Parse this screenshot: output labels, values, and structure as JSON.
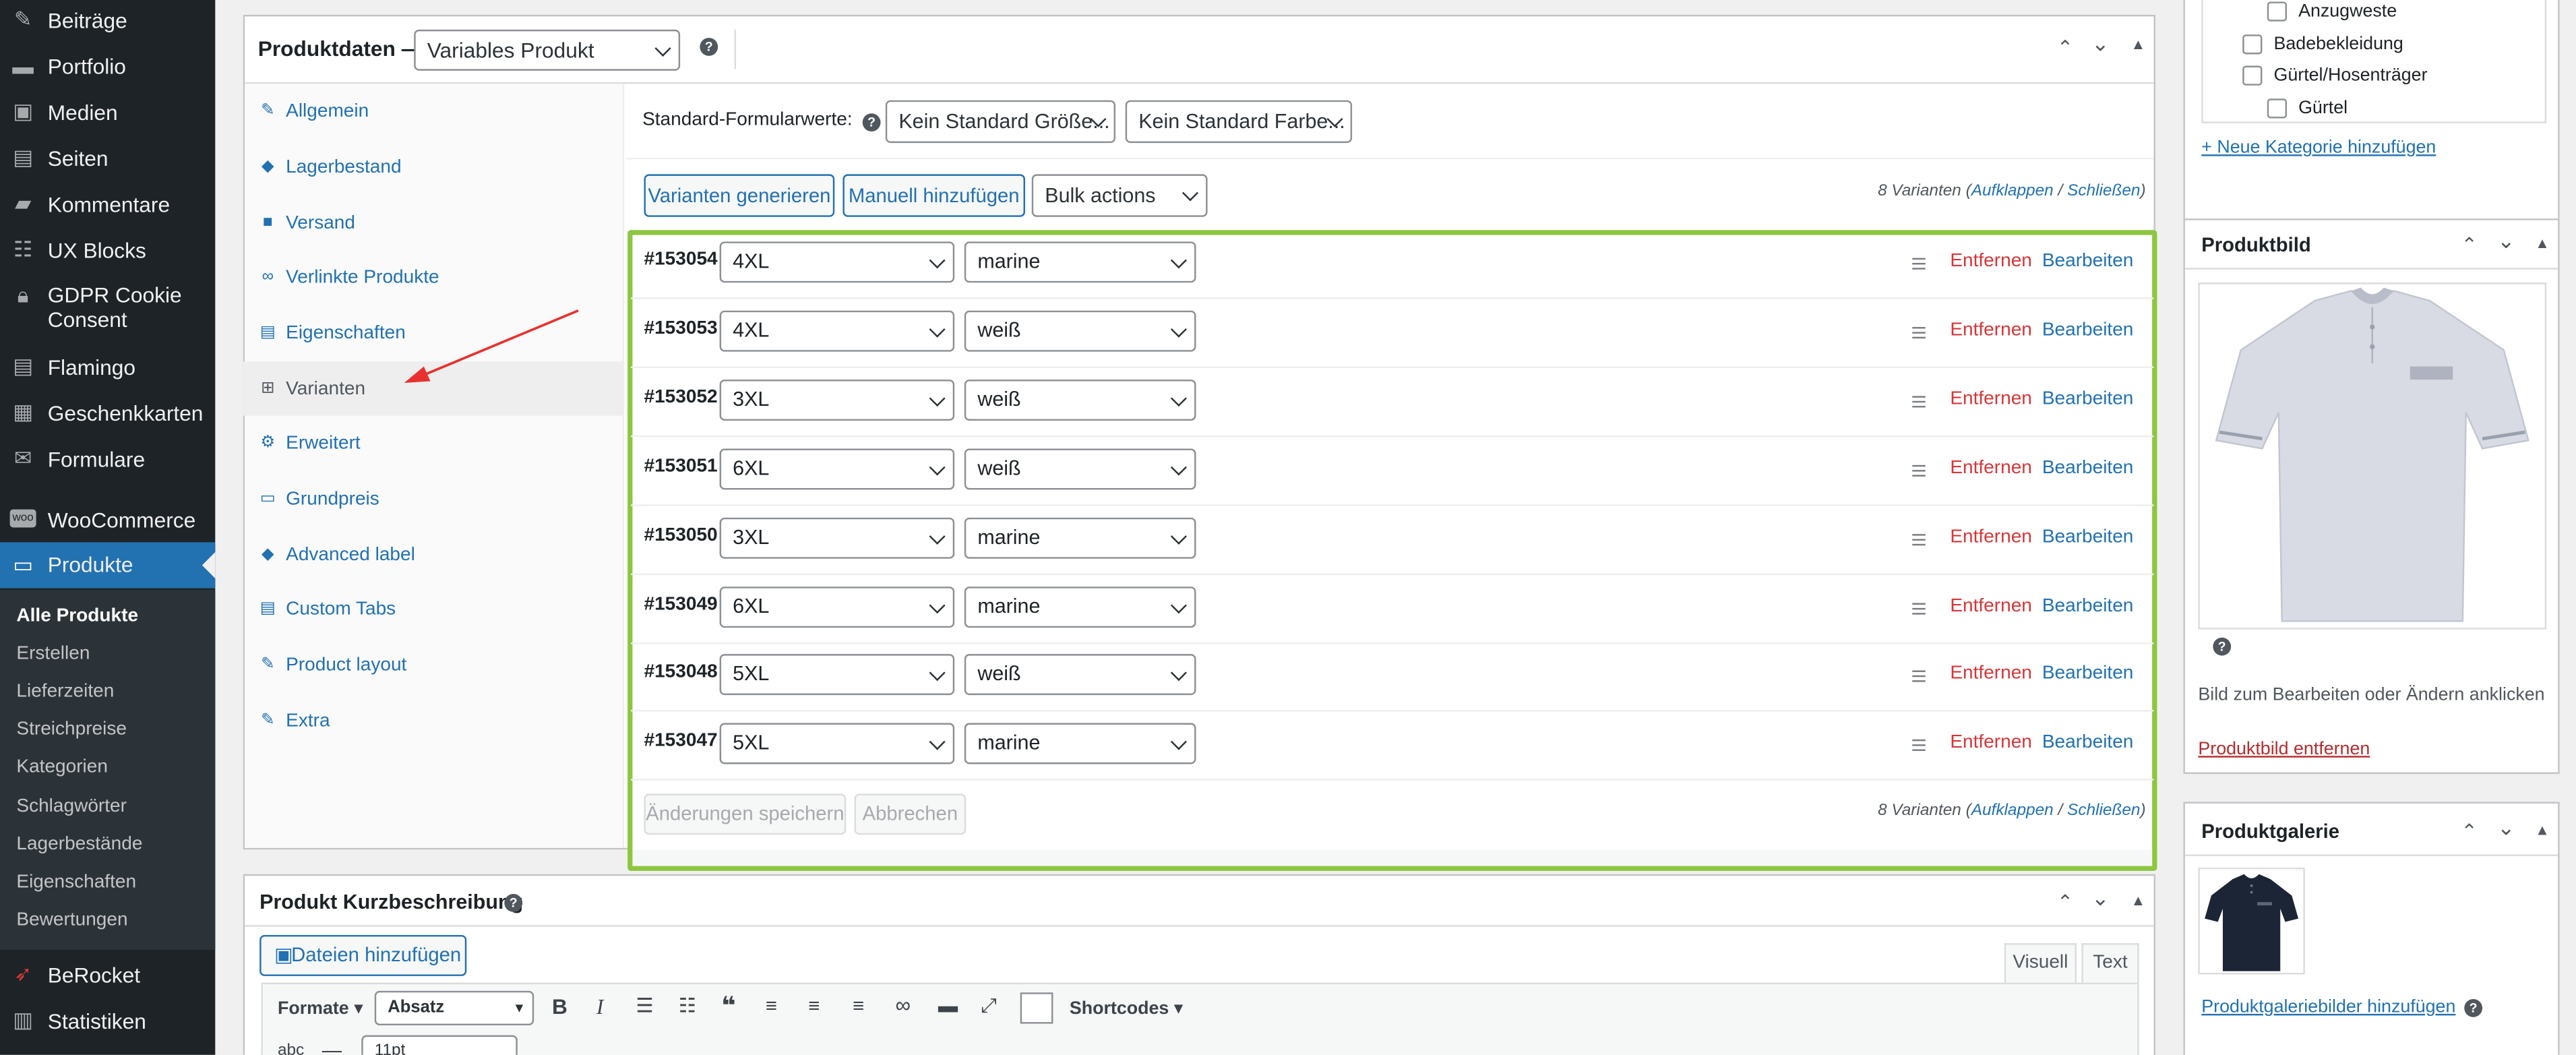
{
  "admin_menu": {
    "items": [
      {
        "label": "Beiträge",
        "icon": "pin-icon"
      },
      {
        "label": "Portfolio",
        "icon": "portfolio-icon"
      },
      {
        "label": "Medien",
        "icon": "media-icon"
      },
      {
        "label": "Seiten",
        "icon": "page-icon"
      },
      {
        "label": "Kommentare",
        "icon": "comment-icon"
      },
      {
        "label": "UX Blocks",
        "icon": "blocks-icon"
      },
      {
        "label": "GDPR Cookie",
        "label2": "Consent",
        "icon": "lock-icon"
      },
      {
        "label": "Flamingo",
        "icon": "flamingo-icon"
      },
      {
        "label": "Geschenkkarten",
        "icon": "giftcard-icon"
      },
      {
        "label": "Formulare",
        "icon": "mail-icon"
      },
      {
        "label": "WooCommerce",
        "icon": "woo-icon"
      },
      {
        "label": "Produkte",
        "icon": "archive-icon"
      },
      {
        "label": "BeRocket",
        "icon": "rocket-icon"
      },
      {
        "label": "Statistiken",
        "icon": "stats-icon"
      }
    ],
    "submenu": [
      "Alle Produkte",
      "Erstellen",
      "Lieferzeiten",
      "Streichpreise",
      "Kategorien",
      "Schlagwörter",
      "Lagerbestände",
      "Eigenschaften",
      "Bewertungen"
    ]
  },
  "product_data": {
    "title": "Produktdaten —",
    "type_select": "Variables Produkt",
    "tabs": [
      {
        "label": "Allgemein",
        "icon": "wrench-icon"
      },
      {
        "label": "Lagerbestand",
        "icon": "tag-icon"
      },
      {
        "label": "Versand",
        "icon": "truck-icon"
      },
      {
        "label": "Verlinkte Produkte",
        "icon": "link-icon"
      },
      {
        "label": "Eigenschaften",
        "icon": "list-icon"
      },
      {
        "label": "Varianten",
        "icon": "grid-icon"
      },
      {
        "label": "Erweitert",
        "icon": "gear-icon"
      },
      {
        "label": "Grundpreis",
        "icon": "card-icon"
      },
      {
        "label": "Advanced label",
        "icon": "tag-icon"
      },
      {
        "label": "Custom Tabs",
        "icon": "list-icon"
      },
      {
        "label": "Product layout",
        "icon": "wrench-icon"
      },
      {
        "label": "Extra",
        "icon": "wrench-icon"
      }
    ],
    "defaults_label": "Standard-Formularwerte:",
    "default_size": "Kein Standard Größe...",
    "default_color": "Kein Standard Farbe...",
    "generate_button": "Varianten generieren",
    "add_manual_button": "Manuell hinzufügen",
    "bulk_select": "Bulk actions",
    "count_text": "8 Varianten (",
    "expand_link": "Aufklappen",
    "sep": " / ",
    "collapse_link": "Schließen",
    "close_paren": ")",
    "remove_label": "Entfernen",
    "edit_label": "Bearbeiten",
    "variations": [
      {
        "id": "#153054",
        "size": "4XL",
        "color": "marine"
      },
      {
        "id": "#153053",
        "size": "4XL",
        "color": "weiß"
      },
      {
        "id": "#153052",
        "size": "3XL",
        "color": "weiß"
      },
      {
        "id": "#153051",
        "size": "6XL",
        "color": "weiß"
      },
      {
        "id": "#153050",
        "size": "3XL",
        "color": "marine"
      },
      {
        "id": "#153049",
        "size": "6XL",
        "color": "marine"
      },
      {
        "id": "#153048",
        "size": "5XL",
        "color": "weiß"
      },
      {
        "id": "#153047",
        "size": "5XL",
        "color": "marine"
      }
    ],
    "save_button": "Änderungen speichern",
    "cancel_button": "Abbrechen"
  },
  "short_desc": {
    "title": "Produkt Kurzbeschreibung",
    "add_media_button": "Dateien hinzufügen",
    "tab_visual": "Visuell",
    "tab_text": "Text",
    "formats_label": "Formate",
    "paragraph_select": "Absatz",
    "shortcodes_label": "Shortcodes",
    "font_size": "11pt"
  },
  "categories": {
    "items": [
      "Anzugweste",
      "Badebekleidung",
      "Gürtel/Hosenträger",
      "Gürtel"
    ],
    "add_link": "+ Neue Kategorie hinzufügen"
  },
  "product_image": {
    "title": "Produktbild",
    "hint": "Bild zum Bearbeiten oder Ändern anklicken",
    "remove_link": "Produktbild entfernen"
  },
  "gallery": {
    "title": "Produktgalerie",
    "add_link": "Produktgaleriebilder hinzufügen"
  },
  "colors": {
    "accent": "#2271b1",
    "highlight_border": "#8dc63f",
    "danger": "#d63638",
    "sidebar": "#1d2327"
  }
}
